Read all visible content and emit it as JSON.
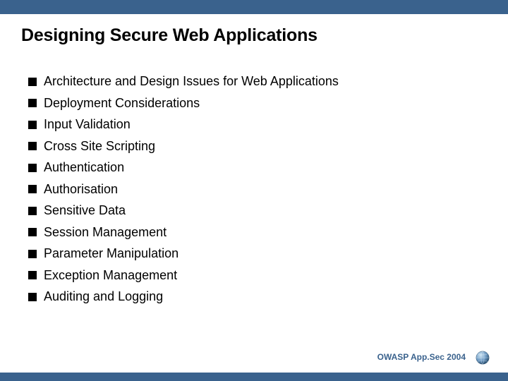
{
  "title": "Designing Secure Web Applications",
  "bullets": [
    "Architecture and Design Issues for Web Applications",
    "Deployment Considerations",
    "Input Validation",
    "Cross Site Scripting",
    "Authentication",
    "Authorisation",
    "Sensitive Data",
    "Session Management",
    "Parameter Manipulation",
    "Exception Management",
    "Auditing and Logging"
  ],
  "footer": "OWASP App.Sec 2004",
  "colors": {
    "brand": "#3a628d"
  }
}
